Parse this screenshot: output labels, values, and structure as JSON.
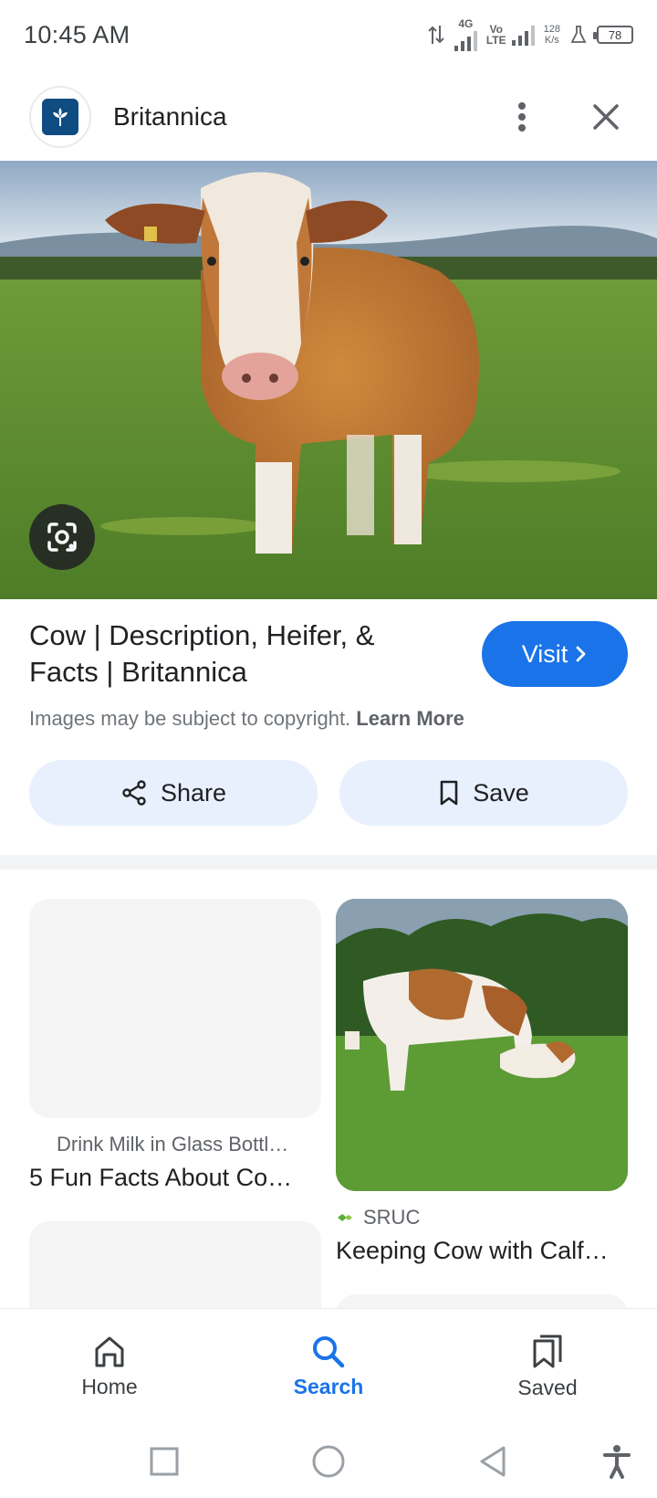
{
  "status_bar": {
    "time": "10:45 AM",
    "network_1": "4G",
    "network_2_top": "Vo",
    "network_2_bottom": "LTE",
    "speed_value": "128",
    "speed_unit": "K/s",
    "battery": "78"
  },
  "header": {
    "site_name": "Britannica",
    "logo_color": "#0f4c81"
  },
  "result": {
    "title": "Cow | Description, Heifer, & Facts | Britannica",
    "visit_label": "Visit",
    "copyright_text": "Images may be subject to copyright.",
    "learn_more": "Learn More",
    "accent_color": "#1a73e8"
  },
  "actions": {
    "share_label": "Share",
    "save_label": "Save"
  },
  "related": [
    {
      "source": "Drink Milk in Glass Bottl…",
      "title": "5 Fun Facts About Co…"
    },
    {
      "source": "SRUC",
      "title": "Keeping Cow with Calf…"
    }
  ],
  "bottom_nav": {
    "items": [
      {
        "label": "Home",
        "icon": "home-icon"
      },
      {
        "label": "Search",
        "icon": "search-icon",
        "active": true
      },
      {
        "label": "Saved",
        "icon": "saved-icon"
      }
    ]
  }
}
